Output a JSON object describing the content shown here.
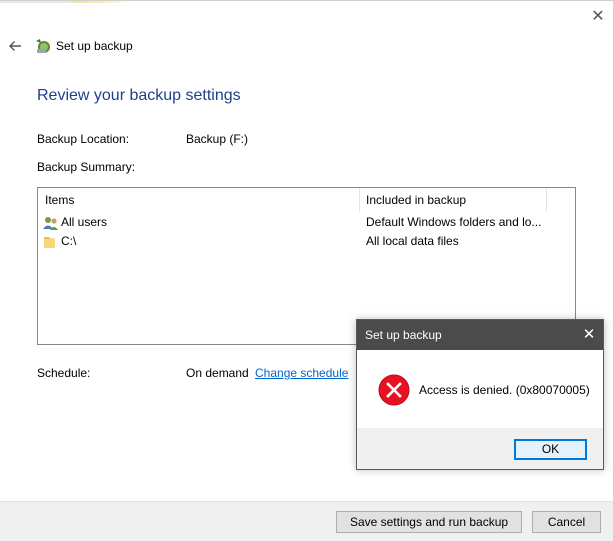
{
  "window": {
    "title": "Set up backup",
    "close_glyph": "✕"
  },
  "page": {
    "heading": "Review your backup settings",
    "backup_location_label": "Backup Location:",
    "backup_location_value": "Backup (F:)",
    "backup_summary_label": "Backup Summary:"
  },
  "items_table": {
    "columns": [
      "Items",
      "Included in backup"
    ],
    "rows": [
      {
        "icon": "users-icon",
        "name": "All users",
        "included": "Default Windows folders and lo..."
      },
      {
        "icon": "folder-icon",
        "name": "C:\\",
        "included": "All local data files"
      }
    ]
  },
  "schedule": {
    "label": "Schedule:",
    "value": "On demand",
    "change_link": "Change schedule"
  },
  "footer": {
    "save_button": "Save settings and run backup",
    "cancel_button": "Cancel"
  },
  "dialog": {
    "title": "Set up backup",
    "close_glyph": "✕",
    "message": "Access is denied. (0x80070005)",
    "ok_button": "OK",
    "icon": "error-icon"
  },
  "colors": {
    "heading": "#1e3f8a",
    "link": "#0066cc",
    "dialog_titlebar": "#4b4b4b",
    "error_red": "#e81123",
    "ok_border": "#0078d7"
  }
}
